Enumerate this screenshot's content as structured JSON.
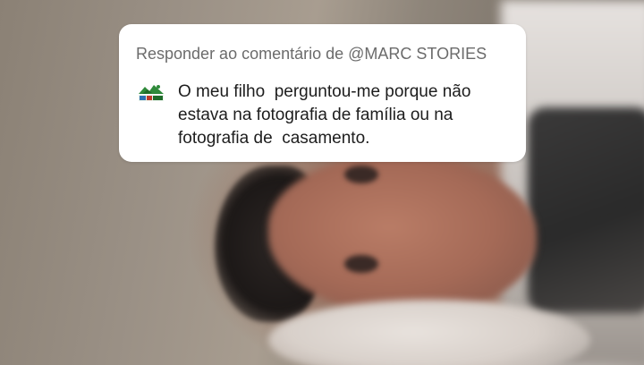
{
  "reply_card": {
    "header": "Responder ao comentário de @MARC STORIES",
    "avatar_icon": "marc-stories-avatar",
    "comment_lines": [
      "O meu filho  perguntou-me porque não",
      "estava na fotografia de família ou na",
      "fotografia de  casamento."
    ]
  },
  "background": {
    "type": "blurred-video-frame"
  },
  "colors": {
    "card_bg": "#ffffff",
    "header_text": "#6b6b6b",
    "comment_text": "#1d1d1d"
  }
}
